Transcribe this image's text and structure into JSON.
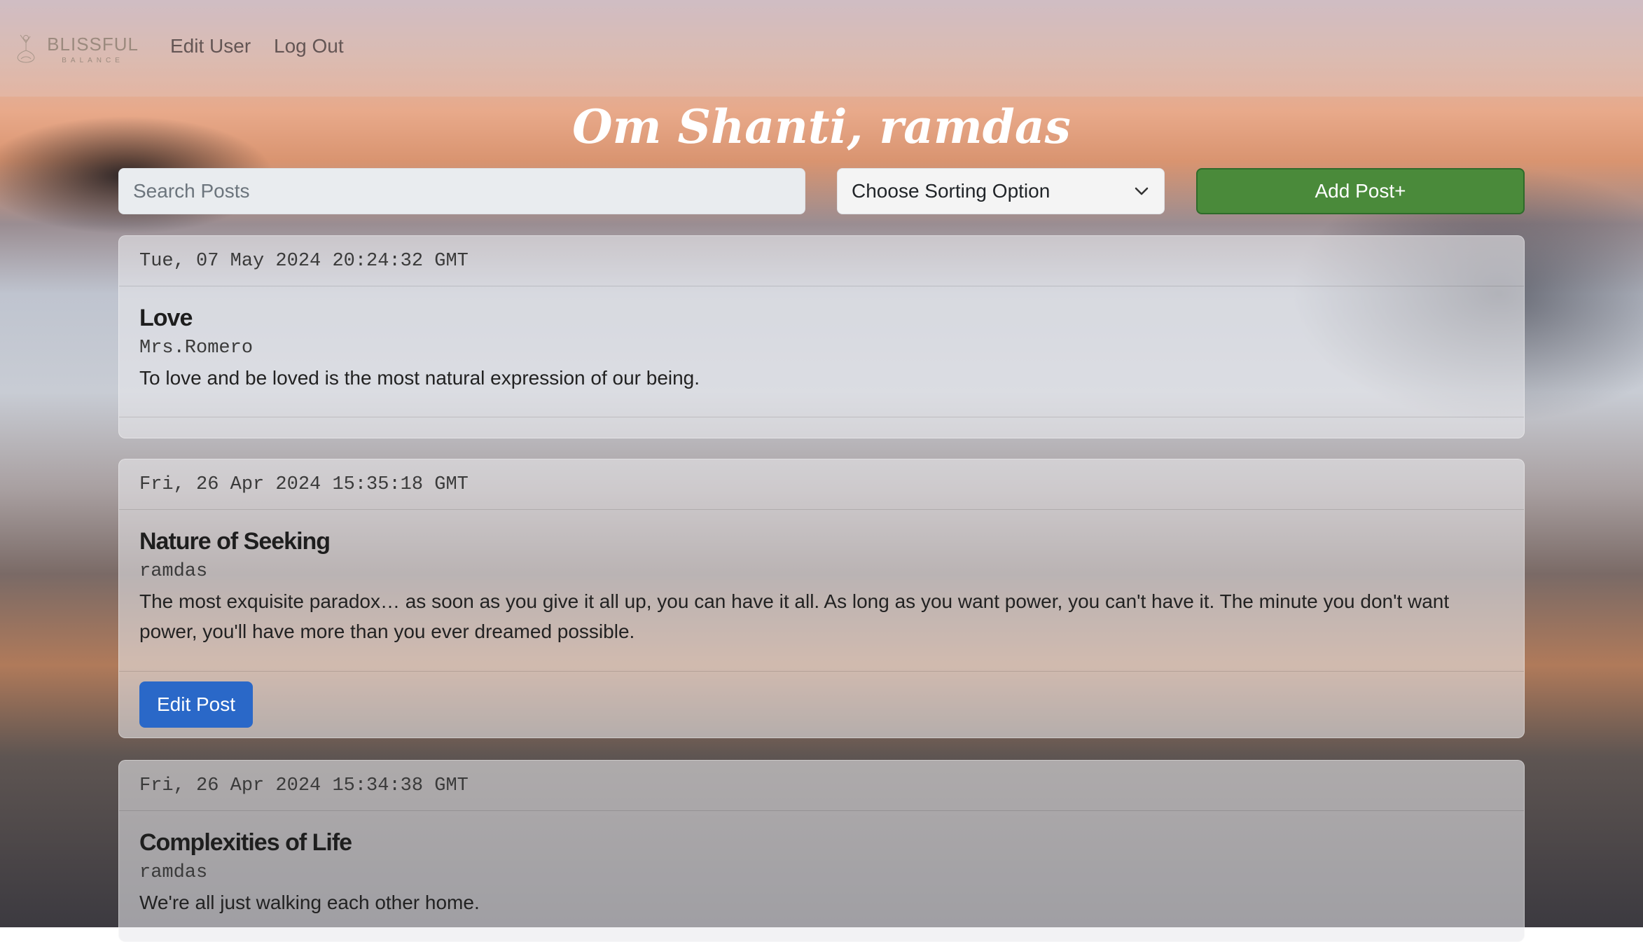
{
  "navbar": {
    "logo_title": "BLISSFUL",
    "logo_subtitle": "BALANCE",
    "links": [
      {
        "label": "Edit User"
      },
      {
        "label": "Log Out"
      }
    ]
  },
  "greeting": "Om Shanti, ramdas",
  "toolbar": {
    "search_placeholder": "Search Posts",
    "sort_label": "Choose Sorting Option",
    "add_label": "Add Post+"
  },
  "posts": [
    {
      "timestamp": "Tue, 07 May 2024 20:24:32 GMT",
      "title": "Love",
      "author": "Mrs.Romero",
      "content": "To love and be loved is the most natural expression of our being."
    },
    {
      "timestamp": "Fri, 26 Apr 2024 15:35:18 GMT",
      "title": "Nature of Seeking",
      "author": "ramdas",
      "content": "The most exquisite paradox… as soon as you give it all up, you can have it all. As long as you want power, you can't have it. The minute you don't want power, you'll have more than you ever dreamed possible.",
      "edit_label": "Edit Post"
    },
    {
      "timestamp": "Fri, 26 Apr 2024 15:34:38 GMT",
      "title": "Complexities of Life",
      "author": "ramdas",
      "content": "We're all just walking each other home."
    }
  ],
  "colors": {
    "add_button": "#4a8a3a",
    "edit_button": "#2a68c8"
  }
}
